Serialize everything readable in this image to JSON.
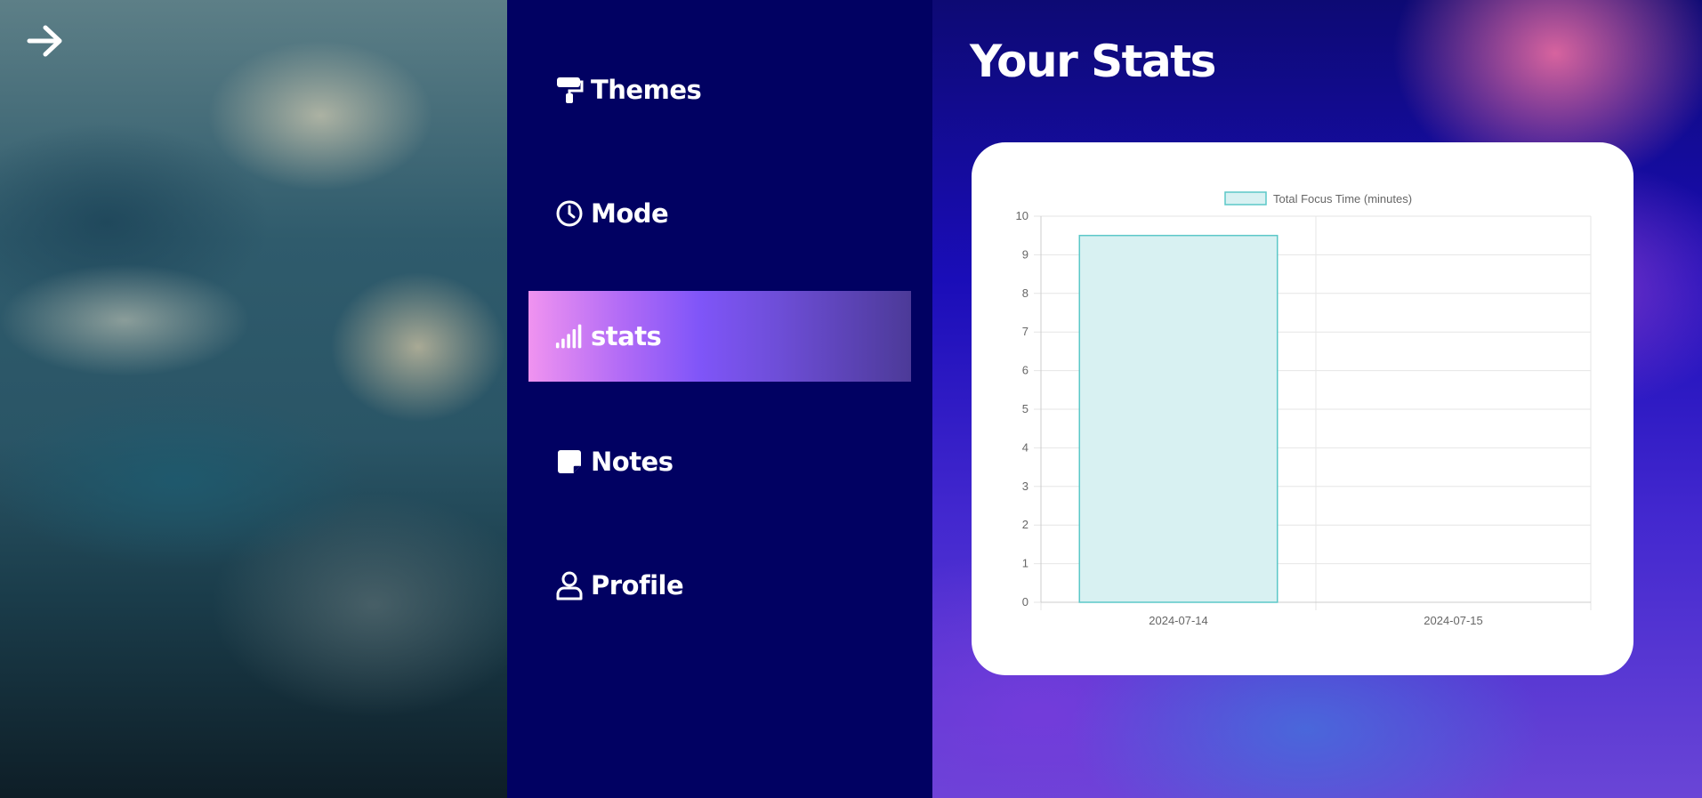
{
  "nav": {
    "back_icon": "arrow-right-icon",
    "items": [
      {
        "label": "Themes",
        "icon": "paint-roller-icon",
        "active": false
      },
      {
        "label": "Mode",
        "icon": "clock-icon",
        "active": false
      },
      {
        "label": "stats",
        "icon": "signal-bars-icon",
        "active": true
      },
      {
        "label": "Notes",
        "icon": "sticky-note-icon",
        "active": false
      },
      {
        "label": "Profile",
        "icon": "user-icon",
        "active": false
      }
    ]
  },
  "main": {
    "title": "Your Stats"
  },
  "colors": {
    "sidebar": "#010162",
    "bar_fill": "#d8f1f2",
    "bar_border": "#5cc8c8"
  },
  "chart_data": {
    "type": "bar",
    "categories": [
      "2024-07-14",
      "2024-07-15"
    ],
    "series": [
      {
        "name": "Total Focus Time (minutes)",
        "values": [
          9.5,
          0
        ]
      }
    ],
    "ylim": [
      0,
      10
    ],
    "yticks": [
      "0",
      "1",
      "2",
      "3",
      "4",
      "5",
      "6",
      "7",
      "8",
      "9",
      "10"
    ],
    "grid": true,
    "legend_position": "top"
  }
}
